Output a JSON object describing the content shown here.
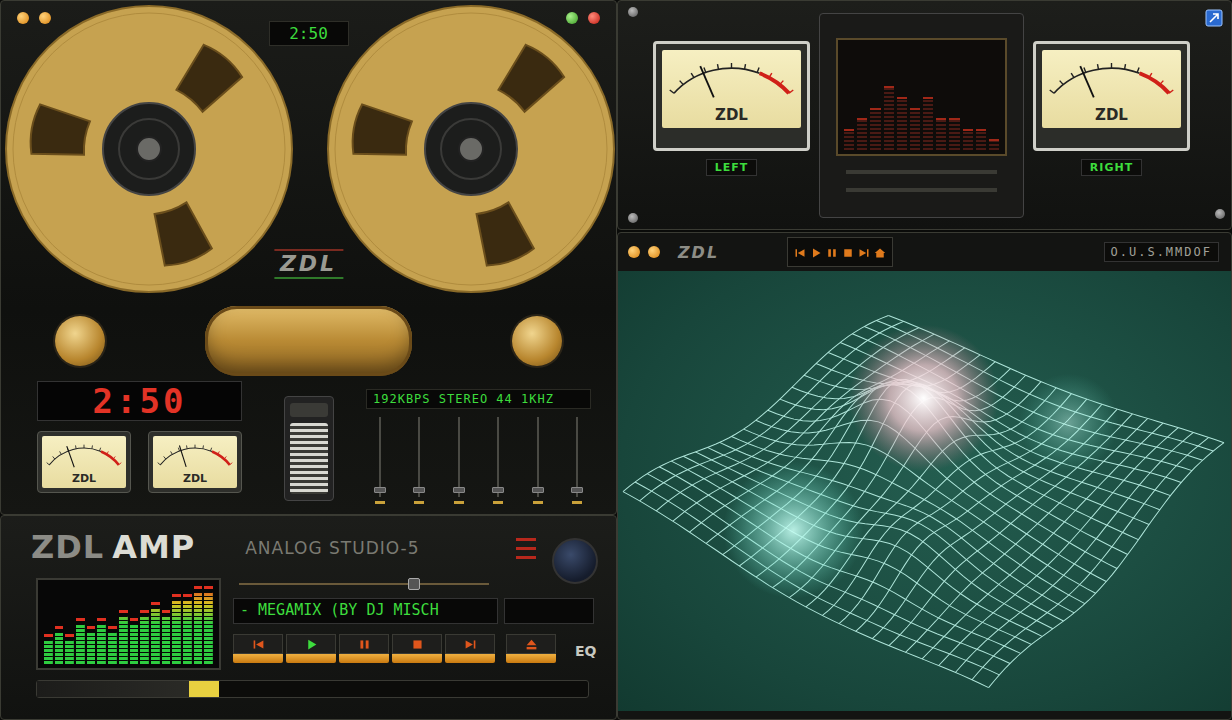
{
  "deck": {
    "counter": "2:50",
    "logo": "ZDL",
    "time": "2:50",
    "stream_info": "192KBPS STEREO 44 1KHZ",
    "meters": [
      {
        "logo": "ZDL",
        "level": 0.3
      },
      {
        "logo": "ZDL",
        "level": 0.32
      }
    ],
    "sliders": [
      {
        "level": 0.05
      },
      {
        "level": 0.05
      },
      {
        "level": 0.05
      },
      {
        "level": 0.05
      },
      {
        "level": 0.05
      },
      {
        "level": 0.05
      }
    ]
  },
  "amp": {
    "brand": "ZDL",
    "product": "AMP",
    "model": "ANALOG STUDIO-5",
    "spectrum": [
      3,
      4,
      3,
      5,
      4,
      5,
      4,
      6,
      5,
      6,
      7,
      6,
      8,
      8,
      9,
      9
    ],
    "volume": {
      "level": 0.7
    },
    "track": "- MEGAMIX (BY DJ MISCH",
    "buttons": [
      {
        "kind": "previous",
        "selected": false
      },
      {
        "kind": "play",
        "selected": true
      },
      {
        "kind": "pause",
        "selected": false
      },
      {
        "kind": "stop",
        "selected": false
      },
      {
        "kind": "next",
        "selected": false
      },
      {
        "kind": "eject",
        "selected": false
      }
    ],
    "eq": "EQ",
    "seek": {
      "level": 0.33
    }
  },
  "vu_window": {
    "channels": [
      {
        "label": "LEFT",
        "logo": "ZDL",
        "level": 0.28
      },
      {
        "label": "RIGHT",
        "logo": "ZDL",
        "level": 0.28
      }
    ],
    "analyzer": [
      2,
      3,
      4,
      6,
      5,
      4,
      5,
      3,
      3,
      2,
      2,
      1
    ]
  },
  "visualizer": {
    "logo": "ZDL",
    "buttons": [
      {
        "kind": "previous"
      },
      {
        "kind": "play"
      },
      {
        "kind": "pause"
      },
      {
        "kind": "stop"
      },
      {
        "kind": "next"
      },
      {
        "kind": "home"
      }
    ],
    "mode": "O.U.S.MMDOF"
  }
}
